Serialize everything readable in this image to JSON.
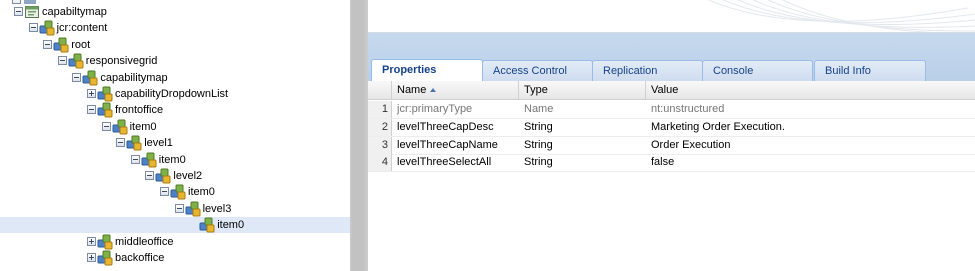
{
  "tree": {
    "nodes": [
      {
        "label": "capabiltymap",
        "toggle": "minus",
        "icon": "page-icon",
        "depth": 0
      },
      {
        "label": "jcr:content",
        "toggle": "minus",
        "icon": "node-icon",
        "depth": 1
      },
      {
        "label": "root",
        "toggle": "minus",
        "icon": "node-icon",
        "depth": 2
      },
      {
        "label": "responsivegrid",
        "toggle": "minus",
        "icon": "node-icon",
        "depth": 3
      },
      {
        "label": "capabilitymap",
        "toggle": "minus",
        "icon": "node-icon",
        "depth": 4
      },
      {
        "label": "capabilityDropdownList",
        "toggle": "plus",
        "icon": "node-icon",
        "depth": 5
      },
      {
        "label": "frontoffice",
        "toggle": "minus",
        "icon": "node-icon",
        "depth": 5
      },
      {
        "label": "item0",
        "toggle": "minus",
        "icon": "node-icon",
        "depth": 6
      },
      {
        "label": "level1",
        "toggle": "minus",
        "icon": "node-icon",
        "depth": 7
      },
      {
        "label": "item0",
        "toggle": "minus",
        "icon": "node-icon",
        "depth": 8
      },
      {
        "label": "level2",
        "toggle": "minus",
        "icon": "node-icon",
        "depth": 9
      },
      {
        "label": "item0",
        "toggle": "minus",
        "icon": "node-icon",
        "depth": 10
      },
      {
        "label": "level3",
        "toggle": "minus",
        "icon": "node-icon",
        "depth": 11
      },
      {
        "label": "item0",
        "toggle": "none",
        "icon": "node-icon",
        "depth": 12,
        "selected": true
      },
      {
        "label": "middleoffice",
        "toggle": "plus",
        "icon": "node-icon",
        "depth": 5
      },
      {
        "label": "backoffice",
        "toggle": "plus",
        "icon": "node-icon",
        "depth": 5
      }
    ]
  },
  "tabs": [
    {
      "label": "Properties",
      "active": true
    },
    {
      "label": "Access Control",
      "active": false
    },
    {
      "label": "Replication",
      "active": false
    },
    {
      "label": "Console",
      "active": false
    },
    {
      "label": "Build Info",
      "active": false
    }
  ],
  "grid": {
    "columns": {
      "name": "Name",
      "type": "Type",
      "value": "Value"
    },
    "sort_column": "name",
    "sort_direction": "ascending",
    "rows": [
      {
        "n": "1",
        "name": "jcr:primaryType",
        "type": "Name",
        "value": "nt:unstructured",
        "protected": true
      },
      {
        "n": "2",
        "name": "levelThreeCapDesc",
        "type": "String",
        "value": "Marketing Order Execution.",
        "protected": false
      },
      {
        "n": "3",
        "name": "levelThreeCapName",
        "type": "String",
        "value": "Order Execution",
        "protected": false
      },
      {
        "n": "4",
        "name": "levelThreeSelectAll",
        "type": "String",
        "value": "false",
        "protected": false
      }
    ]
  },
  "colors": {
    "tab_text": "#15428b",
    "selection": "#dfe8f6",
    "tabstrip": "#c7d9ee"
  }
}
